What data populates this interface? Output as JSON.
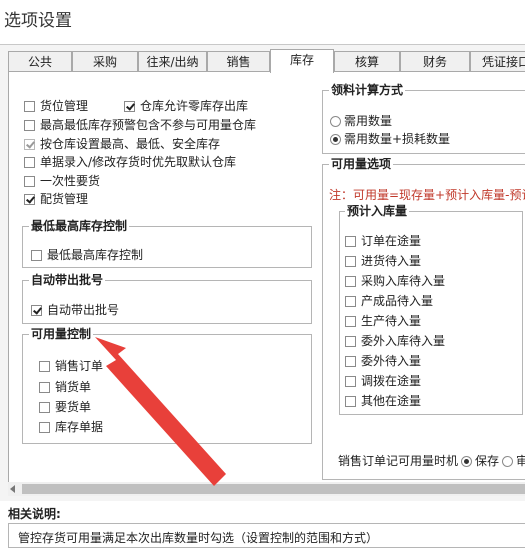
{
  "window": {
    "title": "选项设置"
  },
  "tabs": [
    {
      "label": "公共"
    },
    {
      "label": "采购"
    },
    {
      "label": "往来/出纳"
    },
    {
      "label": "销售"
    },
    {
      "label": "库存"
    },
    {
      "label": "核算"
    },
    {
      "label": "财务"
    },
    {
      "label": "凭证接口"
    }
  ],
  "active_tab": "库存",
  "left": {
    "options": [
      {
        "label": "货位管理",
        "checked": false
      },
      {
        "label": "仓库允许零库存出库",
        "checked": true
      },
      {
        "label": "最高最低库存预警包含不参与可用量仓库",
        "checked": false
      },
      {
        "label": "按仓库设置最高、最低、安全库存",
        "checked": true,
        "disabled": true
      },
      {
        "label": "单据录入/修改存货时优先取默认仓库",
        "checked": false
      },
      {
        "label": "一次性要货",
        "checked": false
      },
      {
        "label": "配货管理",
        "checked": true
      }
    ],
    "group_minmax": {
      "title": "最低最高库存控制",
      "items": [
        {
          "label": "最低最高库存控制",
          "checked": false
        }
      ]
    },
    "group_batch": {
      "title": "自动带出批号",
      "items": [
        {
          "label": "自动带出批号",
          "checked": true
        }
      ]
    },
    "group_avail": {
      "title": "可用量控制",
      "items": [
        {
          "label": "销售订单",
          "checked": false
        },
        {
          "label": "销货单",
          "checked": false
        },
        {
          "label": "要货单",
          "checked": false
        },
        {
          "label": "库存单据",
          "checked": false
        }
      ]
    }
  },
  "right": {
    "material": {
      "title": "领料计算方式",
      "options": [
        {
          "label": "需用数量",
          "selected": false
        },
        {
          "label": "需用数量+损耗数量",
          "selected": true
        }
      ]
    },
    "avail_options": {
      "title": "可用量选项",
      "note": "注：可用量=现存量+预计入库量-预计",
      "note_color": "#c0392b",
      "planned_in": {
        "title": "预计入库量",
        "items": [
          {
            "label": "订单在途量",
            "checked": false
          },
          {
            "label": "进货待入量",
            "checked": false
          },
          {
            "label": "采购入库待入量",
            "checked": false
          },
          {
            "label": "产成品待入量",
            "checked": false
          },
          {
            "label": "生产待入量",
            "checked": false
          },
          {
            "label": "委外入库待入量",
            "checked": false
          },
          {
            "label": "委外待入量",
            "checked": false
          },
          {
            "label": "调拨在途量",
            "checked": false
          },
          {
            "label": "其他在途量",
            "checked": false
          }
        ]
      },
      "footer": {
        "label": "销售订单记可用量时机",
        "save": "保存",
        "audit": "审",
        "selected": "保存"
      }
    }
  },
  "description": {
    "title": "相关说明:",
    "text": "管控存货可用量满足本次出库数量时勾选（设置控制的范围和方式）"
  },
  "annotation_color": "#e8403a"
}
